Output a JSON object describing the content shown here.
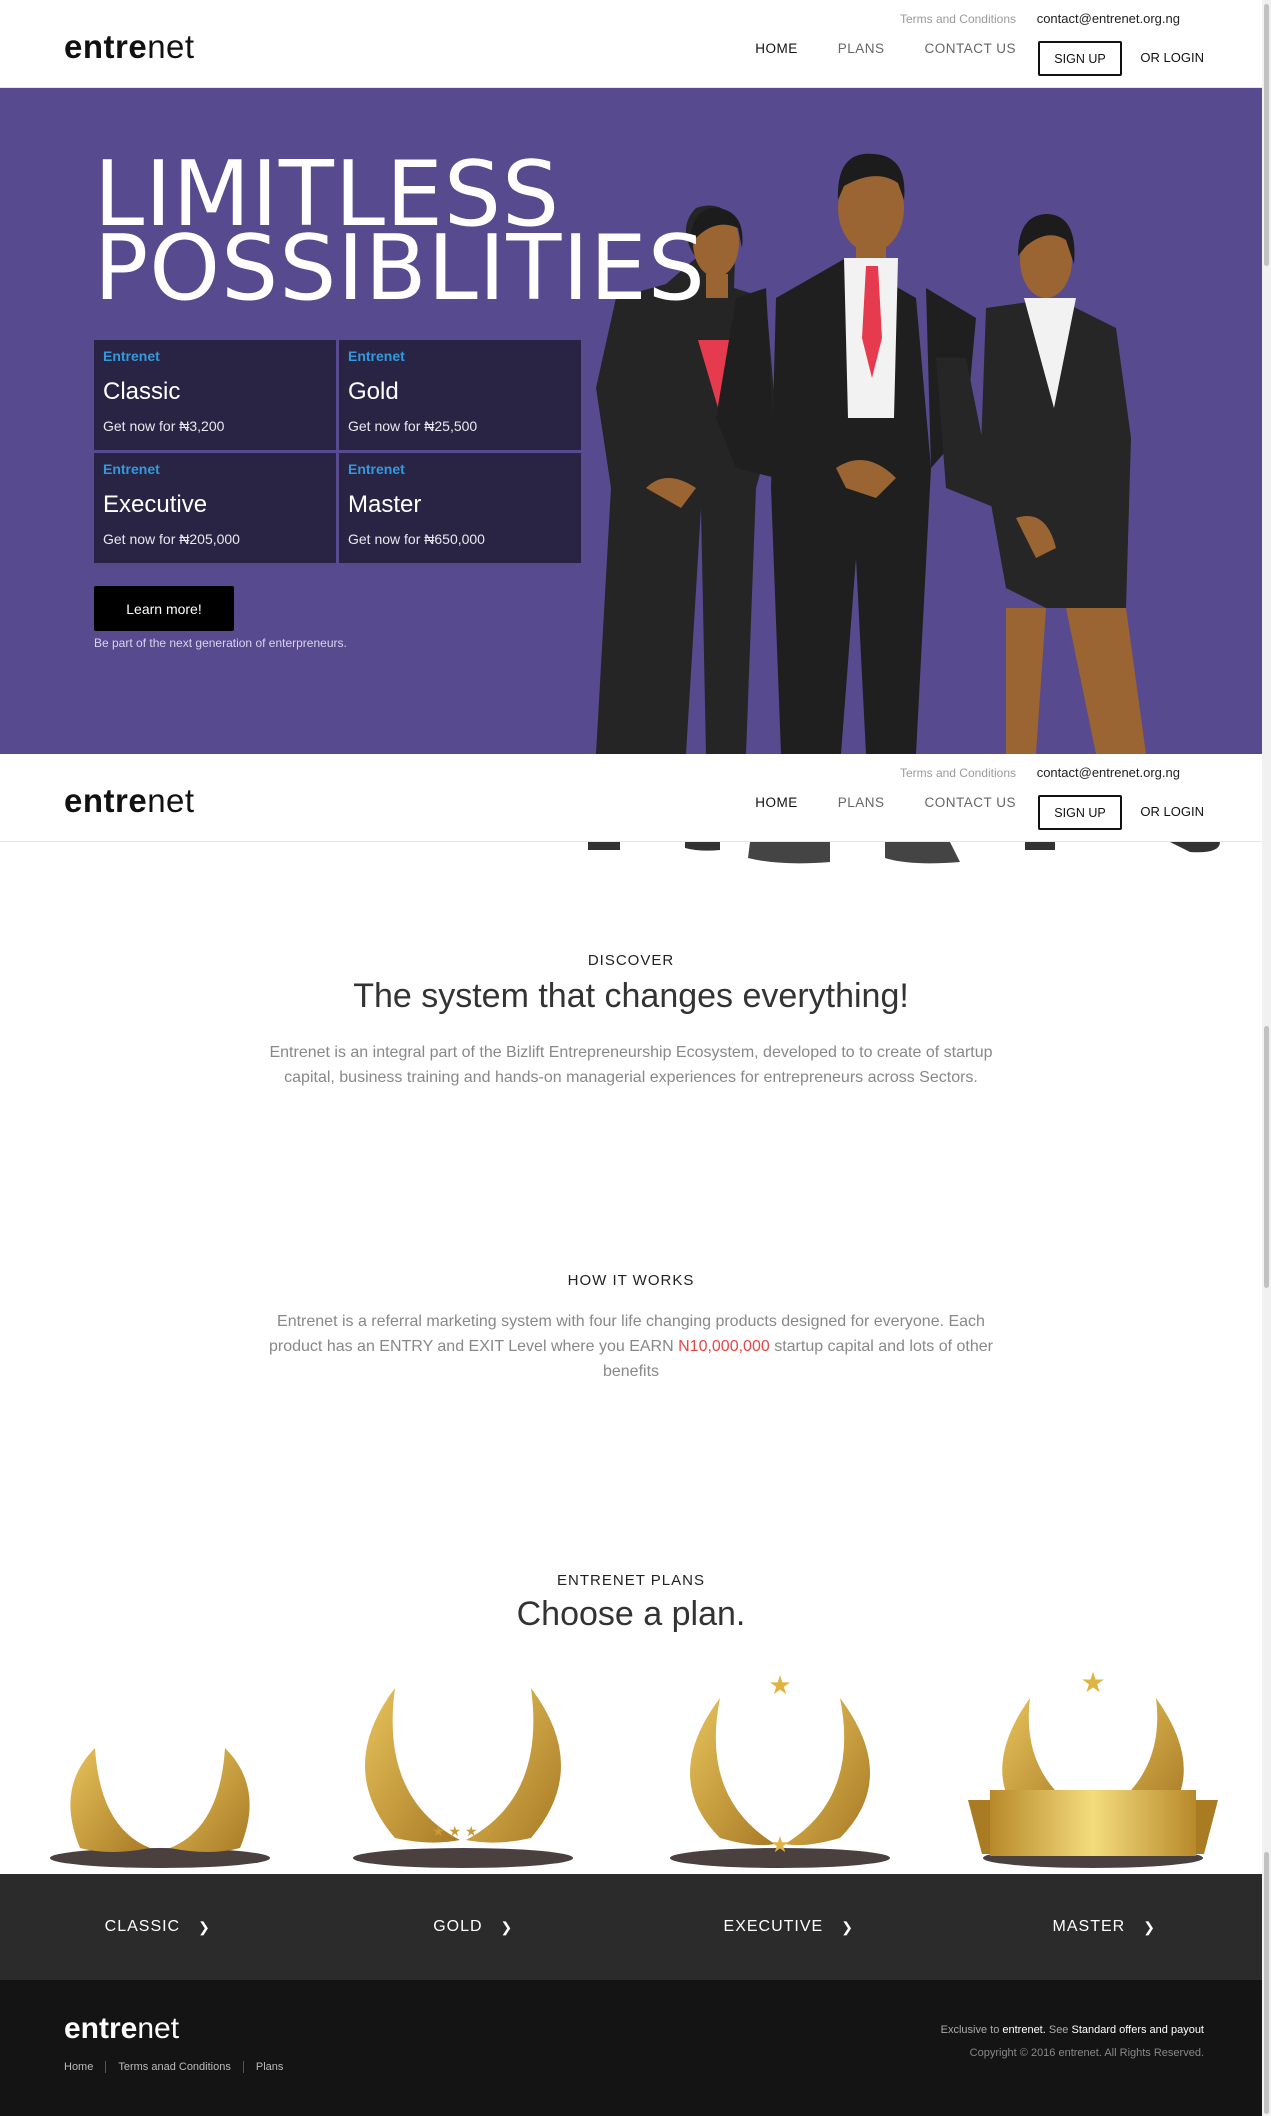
{
  "header": {
    "logo_bold": "entre",
    "logo_thin": "net",
    "terms": "Terms and Conditions",
    "email": "contact@entrenet.org.ng",
    "nav": {
      "home": "HOME",
      "plans": "PLANS",
      "contact": "CONTACT US"
    },
    "signup": "SIGN UP",
    "login": "OR LOGIN"
  },
  "hero": {
    "title_line1": "LIMITLESS",
    "title_line2": "POSSIBLITIES",
    "plans": [
      {
        "brand": "Entrenet",
        "name": "Classic",
        "price": "Get now for ₦3,200"
      },
      {
        "brand": "Entrenet",
        "name": "Gold",
        "price": "Get now for ₦25,500"
      },
      {
        "brand": "Entrenet",
        "name": "Executive",
        "price": "Get now for ₦205,000"
      },
      {
        "brand": "Entrenet",
        "name": "Master",
        "price": "Get now for ₦650,000"
      }
    ],
    "cta": "Learn more!",
    "tagline": "Be part of the next generation of enterpreneurs."
  },
  "discover": {
    "eyebrow": "DISCOVER",
    "title": "The system that changes everything!",
    "text": "Entrenet is an integral part of the Bizlift Entrepreneurship Ecosystem, developed to to create of startup capital, business training and hands-on managerial experiences for entrepreneurs across Sectors."
  },
  "how": {
    "eyebrow": "HOW IT WORKS",
    "text_before": "Entrenet is a referral marketing system with four life changing products designed for everyone. Each product has an ENTRY and EXIT Level where you EARN ",
    "amount": "N10,000,000",
    "text_after": " startup capital and lots of other benefits"
  },
  "plans_section": {
    "eyebrow": "ENTRENET PLANS",
    "title": "Choose a plan.",
    "bar": [
      "CLASSIC",
      "GOLD",
      "EXECUTIVE",
      "MASTER"
    ]
  },
  "footer": {
    "logo_bold": "entre",
    "logo_thin": "net",
    "links": [
      "Home",
      "Terms anad Conditions",
      "Plans"
    ],
    "excl_pre": "Exclusive to ",
    "excl_brand": "entrenet.",
    "excl_mid": " See ",
    "excl_link": "Standard offers and payout",
    "copyright": "Copyright © 2016 entrenet. All Rights Reserved."
  },
  "colors": {
    "hero_bg": "#584a8e",
    "plan_box": "#2a2444",
    "brand_blue": "#3399dd",
    "highlight_red": "#e84545",
    "gold": "#c79a3a"
  },
  "icons": [
    "chevron-right-icon",
    "laurel-wreath-icon",
    "star-icon",
    "ribbon-banner-icon"
  ]
}
